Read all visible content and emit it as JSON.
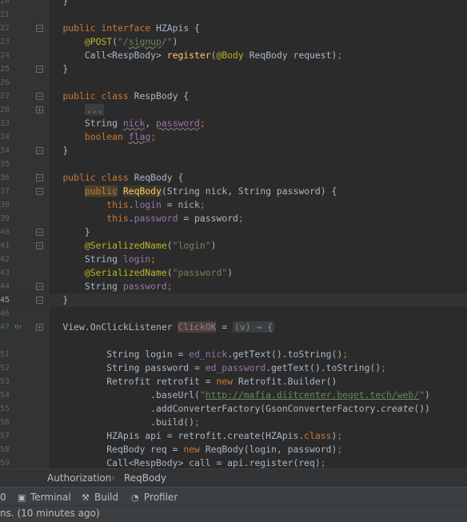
{
  "editor": {
    "lines": [
      {
        "n": "20",
        "cls": "",
        "fold": "",
        "mark": "",
        "html": "    }"
      },
      {
        "n": "21",
        "cls": "",
        "fold": "",
        "mark": "",
        "html": ""
      },
      {
        "n": "22",
        "cls": "",
        "fold": "⊟",
        "mark": "",
        "html": "    <span class='kw'>public interface</span> HZApis {"
      },
      {
        "n": "23",
        "cls": "",
        "fold": "",
        "mark": "",
        "html": "        <span class='ann'>@POST</span>(<span class='str'>\"/<span class='squig'>signup</span>/\"</span>)"
      },
      {
        "n": "24",
        "cls": "",
        "fold": "",
        "mark": "",
        "html": "        Call&lt;RespBody&gt; <span class='fn'>register</span>(<span class='ann'>@Body</span> ReqBody request)<span class='kw'>;</span>"
      },
      {
        "n": "25",
        "cls": "",
        "fold": "⊟",
        "mark": "",
        "html": "    }"
      },
      {
        "n": "26",
        "cls": "",
        "fold": "",
        "mark": "",
        "html": ""
      },
      {
        "n": "27",
        "cls": "",
        "fold": "⊟",
        "mark": "",
        "html": "    <span class='kw'>public class</span> RespBody {"
      },
      {
        "n": "28",
        "cls": "",
        "fold": "⊞",
        "mark": "",
        "html": "        <span class='fold-block'>...</span>"
      },
      {
        "n": "33",
        "cls": "",
        "fold": "",
        "mark": "",
        "html": "        String <span class='fld squig'>nick</span>, <span class='fld squig'>password</span><span class='kw'>;</span>"
      },
      {
        "n": "34",
        "cls": "",
        "fold": "",
        "mark": "",
        "html": "        <span class='kw'>boolean</span> <span class='fld squig'>flag</span><span class='kw'>;</span>"
      },
      {
        "n": "34",
        "cls": "",
        "fold": "⊟",
        "mark": "",
        "html": "    }"
      },
      {
        "n": "35",
        "cls": "",
        "fold": "",
        "mark": "",
        "html": ""
      },
      {
        "n": "36",
        "cls": "",
        "fold": "⊟",
        "mark": "",
        "html": "    <span class='kw'>public class</span> ReqBody {"
      },
      {
        "n": "37",
        "cls": "",
        "fold": "⊟",
        "mark": "",
        "html": "        <span class='kw hl2'>public</span> <span class='fn hl'>ReqBody</span>(String nick, String password) {"
      },
      {
        "n": "38",
        "cls": "",
        "fold": "",
        "mark": "",
        "html": "            <span class='kw'>this</span>.<span class='fld'>login</span> = nick<span class='kw'>;</span>"
      },
      {
        "n": "39",
        "cls": "",
        "fold": "",
        "mark": "",
        "html": "            <span class='kw'>this</span>.<span class='fld'>password</span> = password<span class='kw'>;</span>"
      },
      {
        "n": "40",
        "cls": "",
        "fold": "⊟",
        "mark": "",
        "html": "        }"
      },
      {
        "n": "41",
        "cls": "",
        "fold": "⊟",
        "mark": "",
        "html": "        <span class='ann'>@SerializedName</span>(<span class='str'>\"login\"</span>)"
      },
      {
        "n": "42",
        "cls": "",
        "fold": "",
        "mark": "",
        "html": "        String <span class='fld'>login</span><span class='kw'>;</span>"
      },
      {
        "n": "43",
        "cls": "",
        "fold": "",
        "mark": "",
        "html": "        <span class='ann'>@SerializedName</span>(<span class='str'>\"password\"</span>)"
      },
      {
        "n": "44",
        "cls": "",
        "fold": "⊟",
        "mark": "",
        "html": "        String <span class='fld'>password</span><span class='kw'>;</span>"
      },
      {
        "n": "45",
        "cls": "current",
        "fold": "⊟",
        "mark": "",
        "html": "    }"
      },
      {
        "n": "46",
        "cls": "",
        "fold": "",
        "mark": "",
        "html": ""
      },
      {
        "n": "47",
        "cls": "",
        "fold": "⊞",
        "mark": "o↑",
        "html": "    View.OnClickListener <span class='fld hl2'>ClickOK</span> = <span class='fold-block'>(v) → {</span>"
      },
      {
        "n": "",
        "cls": "",
        "fold": "",
        "mark": "",
        "html": ""
      },
      {
        "n": "51",
        "cls": "",
        "fold": "",
        "mark": "",
        "html": "            String login = <span class='fld'>ed_nick</span>.getText().toString()<span class='kw'>;</span>"
      },
      {
        "n": "52",
        "cls": "",
        "fold": "",
        "mark": "",
        "html": "            String password = <span class='fld'>ed_password</span>.getText().toString()<span class='kw'>;</span>"
      },
      {
        "n": "53",
        "cls": "",
        "fold": "",
        "mark": "",
        "html": "            Retrofit retrofit = <span class='kw'>new</span> Retrofit.Builder()"
      },
      {
        "n": "54",
        "cls": "",
        "fold": "",
        "mark": "",
        "html": "                    .baseUrl(<span class='str'>\"<span class='link'>http://mafia.diitcenter.beget.tech/web/</span>\"</span>)"
      },
      {
        "n": "55",
        "cls": "",
        "fold": "",
        "mark": "",
        "html": "                    .addConverterFactory(GsonConverterFactory.<span class='it'>create</span>())"
      },
      {
        "n": "56",
        "cls": "",
        "fold": "",
        "mark": "",
        "html": "                    .build()<span class='kw'>;</span>"
      },
      {
        "n": "57",
        "cls": "",
        "fold": "",
        "mark": "",
        "html": "            HZApis api = retrofit.create(HZApis.<span class='kw'>class</span>)<span class='kw'>;</span>"
      },
      {
        "n": "58",
        "cls": "",
        "fold": "",
        "mark": "",
        "html": "            ReqBody req = <span class='kw'>new</span> ReqBody(login, password)<span class='kw'>;</span>"
      },
      {
        "n": "59",
        "cls": "",
        "fold": "",
        "mark": "",
        "html": "            Call&lt;RespBody&gt; call = api.register(req)<span class='kw'>;</span>"
      }
    ]
  },
  "breadcrumb": {
    "items": [
      "Authorization",
      "ReqBody"
    ],
    "separator": "›"
  },
  "toolwindows": {
    "first": "0",
    "terminal": "Terminal",
    "build": "Build",
    "profiler": "Profiler",
    "terminal_icon": "terminal-icon",
    "build_icon": "hammer-icon",
    "profiler_icon": "gauge-icon"
  },
  "status": {
    "text": "ns. (10 minutes ago)"
  }
}
